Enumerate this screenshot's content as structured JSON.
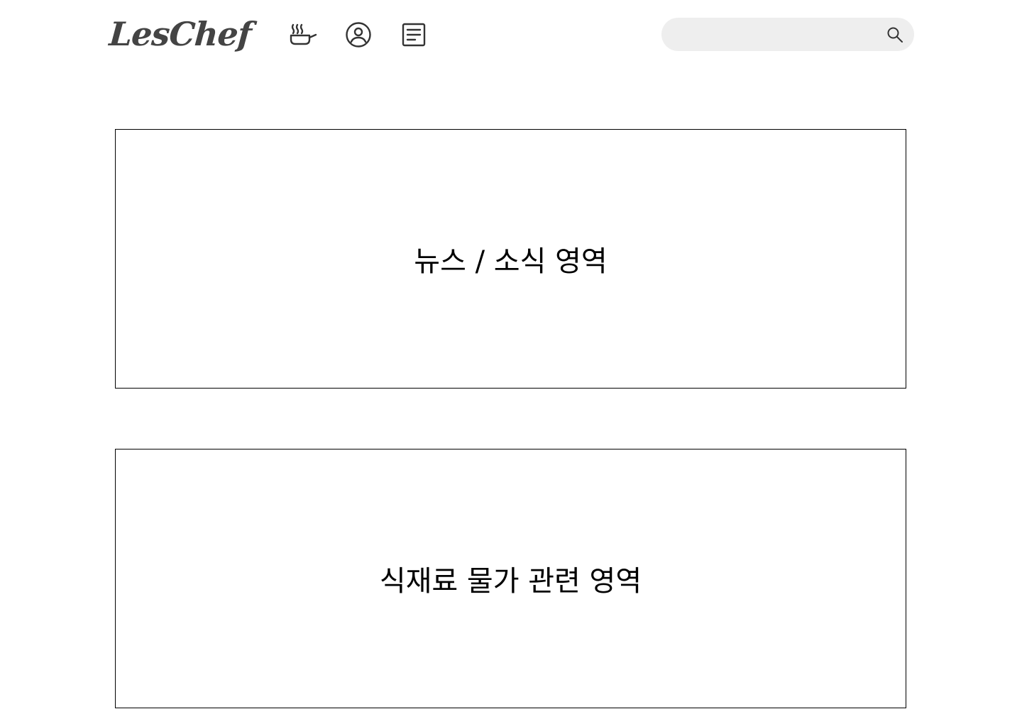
{
  "header": {
    "logo_text": "LesChef",
    "nav": [
      {
        "icon": "cooking-pot-icon"
      },
      {
        "icon": "user-circle-icon"
      },
      {
        "icon": "document-icon"
      }
    ],
    "search": {
      "placeholder": "",
      "value": "",
      "icon": "search-icon"
    }
  },
  "main": {
    "sections": [
      {
        "title": "뉴스 / 소식 영역"
      },
      {
        "title": "식재료 물가 관련 영역"
      }
    ]
  },
  "colors": {
    "logo": "#444444",
    "icon": "#333333",
    "search_bg": "#eeeeee",
    "border": "#000000"
  }
}
